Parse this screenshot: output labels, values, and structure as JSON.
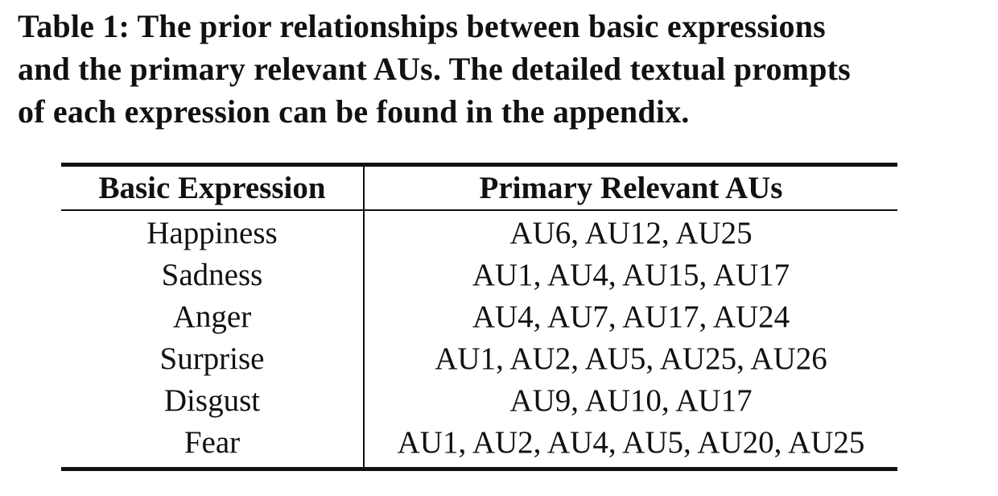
{
  "caption": {
    "lines": [
      "Table 1: The prior relationships between basic expressions",
      "and the primary relevant AUs. The detailed textual prompts",
      "of each expression can be found in the appendix."
    ]
  },
  "table": {
    "headers": [
      "Basic Expression",
      "Primary Relevant AUs"
    ],
    "rows": [
      [
        "Happiness",
        "AU6, AU12, AU25"
      ],
      [
        "Sadness",
        "AU1, AU4, AU15, AU17"
      ],
      [
        "Anger",
        "AU4, AU7, AU17, AU24"
      ],
      [
        "Surprise",
        "AU1, AU2, AU5, AU25, AU26"
      ],
      [
        "Disgust",
        "AU9, AU10, AU17"
      ],
      [
        "Fear",
        "AU1, AU2, AU4, AU5, AU20, AU25"
      ]
    ]
  }
}
